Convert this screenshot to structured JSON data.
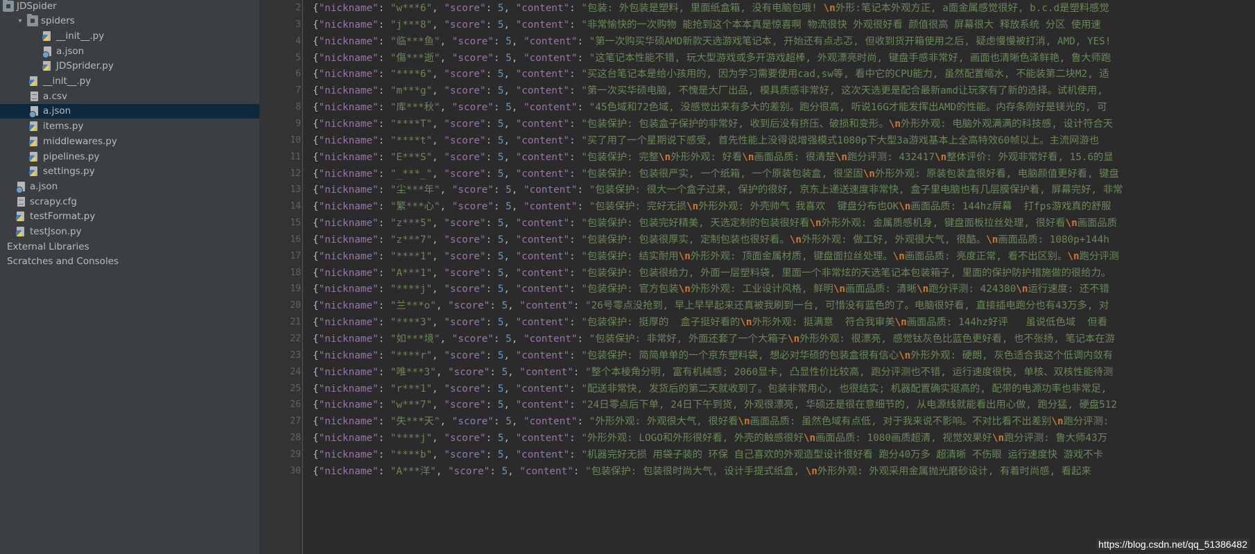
{
  "tree": [
    {
      "label": "JDSpider",
      "icon": "folder",
      "indent": 0,
      "arrow": ""
    },
    {
      "label": "spiders",
      "icon": "folder",
      "indent": 1,
      "arrow": "▾"
    },
    {
      "label": "__init__.py",
      "icon": "py",
      "indent": 3,
      "arrow": ""
    },
    {
      "label": "a.json",
      "icon": "json",
      "indent": 3,
      "arrow": ""
    },
    {
      "label": "JDSprider.py",
      "icon": "py",
      "indent": 3,
      "arrow": ""
    },
    {
      "label": "__init__.py",
      "icon": "py",
      "indent": 2,
      "arrow": ""
    },
    {
      "label": "a.csv",
      "icon": "csv",
      "indent": 2,
      "arrow": ""
    },
    {
      "label": "a.json",
      "icon": "json",
      "indent": 2,
      "arrow": "",
      "selected": true
    },
    {
      "label": "items.py",
      "icon": "py",
      "indent": 2,
      "arrow": ""
    },
    {
      "label": "middlewares.py",
      "icon": "py",
      "indent": 2,
      "arrow": ""
    },
    {
      "label": "pipelines.py",
      "icon": "py",
      "indent": 2,
      "arrow": ""
    },
    {
      "label": "settings.py",
      "icon": "py",
      "indent": 2,
      "arrow": ""
    },
    {
      "label": "a.json",
      "icon": "json",
      "indent": 1,
      "arrow": ""
    },
    {
      "label": "scrapy.cfg",
      "icon": "cfg",
      "indent": 1,
      "arrow": ""
    },
    {
      "label": "testFormat.py",
      "icon": "py",
      "indent": 1,
      "arrow": ""
    },
    {
      "label": "testJson.py",
      "icon": "py",
      "indent": 1,
      "arrow": ""
    },
    {
      "label": "External Libraries",
      "icon": "lib",
      "indent": 0,
      "arrow": ""
    },
    {
      "label": "Scratches and Consoles",
      "icon": "lib",
      "indent": 0,
      "arrow": ""
    }
  ],
  "code_keys": {
    "nickname": "\"nickname\"",
    "score": "\"score\"",
    "content": "\"content\""
  },
  "lines": [
    {
      "num": "2",
      "nickname": "w***6",
      "score": "5",
      "content": [
        "包装: 外包装是塑料, 里面纸盒箱, 没有电脑包哦! ",
        "\\n",
        "外形:笔记本外观方正, a面金属感觉很好, b.c.d是塑料感觉"
      ]
    },
    {
      "num": "3",
      "nickname": "j***8",
      "score": "5",
      "content": [
        "非常愉快的一次购物 能抢到这个本本真是惊喜啊 物流很快 外观很好看 颜值很高 屏幕很大 释放系统 分区 使用速"
      ]
    },
    {
      "num": "4",
      "nickname": "临***鱼",
      "score": "5",
      "content": [
        "第一次购买华硕AMD新款天选游戏笔记本, 开始还有点忐忑, 但收到货开箱使用之后, 疑虑慢慢被打消, AMD, YES!"
      ]
    },
    {
      "num": "5",
      "nickname": "傷***逝",
      "score": "5",
      "content": [
        "这笔记本性能不错, 玩大型游戏或多开游戏超棒, 外观漂亮时尚, 键盘手感非常好, 画面也清晰色泽鲜艳, 鲁大师跑"
      ]
    },
    {
      "num": "6",
      "nickname": "****6",
      "score": "5",
      "content": [
        "买这台笔记本是给小孩用的, 因为学习需要使用cad,sw等, 看中它的CPU能力, 虽然配置缩水, 不能装第二块M2, 适"
      ]
    },
    {
      "num": "7",
      "nickname": "m***g",
      "score": "5",
      "content": [
        "第一次买华硕电脑, 不愧是大厂出品, 模具质感非常好, 这次天选更是配合最新amd让玩家有了新的选择。试机使用,"
      ]
    },
    {
      "num": "8",
      "nickname": "库***秋",
      "score": "5",
      "content": [
        "45色域和72色域, 没感觉出来有多大的差别。跑分很高, 听说16G才能发挥出AMD的性能。内存条刚好是镁光的, 可"
      ]
    },
    {
      "num": "9",
      "nickname": "****T",
      "score": "5",
      "content": [
        "包装保护: 包装盒子保护的非常好, 收到后没有挤压、破损和变形。",
        "\\n",
        "外形外观: 电脑外观满满的科技感, 设计符合天"
      ]
    },
    {
      "num": "10",
      "nickname": "****t",
      "score": "5",
      "content": [
        "买了用了一个星期说下感受, 首先性能上没得说增强模式1080p下大型3a游戏基本上全高特效60帧以上。主流网游也"
      ]
    },
    {
      "num": "11",
      "nickname": "E***S",
      "score": "5",
      "content": [
        "包装保护: 完整",
        "\\n",
        "外形外观: 好看",
        "\\n",
        "画面品质: 很清楚",
        "\\n",
        "跑分评测: 432417",
        "\\n",
        "整体评价: 外观非常好看, 15.6的显"
      ]
    },
    {
      "num": "12",
      "nickname": "_***_",
      "score": "5",
      "content": [
        "包装保护: 包装很严实, 一个纸箱, 一个原装包装盒, 很坚固",
        "\\n",
        "外形外观: 原装包装盒很好看, 电脑颜值更好看, 键盘"
      ]
    },
    {
      "num": "13",
      "nickname": "尘***年",
      "score": "5",
      "content": [
        "包装保护: 很大一个盒子过来, 保护的很好, 京东上递送速度非常快, 盒子里电脑也有几层膜保护着, 屏幕完好, 非常"
      ]
    },
    {
      "num": "14",
      "nickname": "繁***心",
      "score": "5",
      "content": [
        "包装保护: 完好无损",
        "\\n",
        "外形外观: 外壳帅气 我喜欢  键盘分布也OK",
        "\\n",
        "画面品质: 144hz屏幕  打fps游戏真的舒服"
      ]
    },
    {
      "num": "15",
      "nickname": "z***5",
      "score": "5",
      "content": [
        "包装保护: 包装完好精美, 天选定制的包装很好看",
        "\\n",
        "外形外观: 金属质感机身, 键盘面板拉丝处理, 很好看",
        "\\n",
        "画面品质"
      ]
    },
    {
      "num": "16",
      "nickname": "z***7",
      "score": "5",
      "content": [
        "包装保护: 包装很厚实, 定制包装也很好看。",
        "\\n",
        "外形外观: 做工好, 外观很大气, 很酷。",
        "\\n",
        "画面品质: 1080p+144h"
      ]
    },
    {
      "num": "17",
      "nickname": "****1",
      "score": "5",
      "content": [
        "包装保护: 结实耐用",
        "\\n",
        "外形外观: 顶面金属材质, 键盘面拉丝处理。",
        "\\n",
        "画面品质: 亮度正常, 看不出区别。",
        "\\n",
        "跑分评测"
      ]
    },
    {
      "num": "18",
      "nickname": "A***1",
      "score": "5",
      "content": [
        "包装保护: 包装很给力, 外面一层塑料袋, 里面一个非常炫的天选笔记本包装箱子, 里面的保护防护措施做的很给力。"
      ]
    },
    {
      "num": "19",
      "nickname": "****j",
      "score": "5",
      "content": [
        "包装保护: 官方包装",
        "\\n",
        "外形外观: 工业设计风格, 鲜明",
        "\\n",
        "画面品质: 清晰",
        "\\n",
        "跑分评测: 424380",
        "\\n",
        "运行速度: 还不错"
      ]
    },
    {
      "num": "20",
      "nickname": "兰***o",
      "score": "5",
      "content": [
        "26号零点没抢到, 早上早早起来还真被我刷到一台, 可惜没有蓝色的了。电脑很好看, 直接插电跑分也有43万多, 对"
      ]
    },
    {
      "num": "21",
      "nickname": "****3",
      "score": "5",
      "content": [
        "包装保护: 挺厚的  盒子挺好看的",
        "\\n",
        "外形外观: 挺满意  符合我审美",
        "\\n",
        "画面品质: 144hz好评   虽说低色域  但看"
      ]
    },
    {
      "num": "22",
      "nickname": "如***境",
      "score": "5",
      "content": [
        "包装保护: 非常好, 外面还套了一个大箱子",
        "\\n",
        "外形外观: 很漂亮, 感觉钛灰色比蓝色更好看, 也不张扬, 笔记本在游"
      ]
    },
    {
      "num": "23",
      "nickname": "****r",
      "score": "5",
      "content": [
        "包装保护: 简简单单的一个京东塑料袋, 想必对华硕的包装盒很有信心",
        "\\n",
        "外形外观: 硬朗, 灰色适合我这个低调内敛有"
      ]
    },
    {
      "num": "24",
      "nickname": "唯***3",
      "score": "5",
      "content": [
        "整个本棱角分明, 富有机械感; 2060显卡, 凸显性价比较高, 跑分评测也不错, 运行速度很快, 单核、双核性能待测"
      ]
    },
    {
      "num": "25",
      "nickname": "r***1",
      "score": "5",
      "content": [
        "配送非常快, 发货后的第二天就收到了。包装非常用心, 也很结实; 机器配置确实挺高的, 配带的电源功率也非常足,"
      ]
    },
    {
      "num": "26",
      "nickname": "w***7",
      "score": "5",
      "content": [
        "24日零点后下单, 24日下午到货, 外观很漂亮, 华硕还是很在意细节的, 从电源线就能看出用心做, 跑分猛, 硬盘512"
      ]
    },
    {
      "num": "27",
      "nickname": "失***天",
      "score": "5",
      "content": [
        "外形外观: 外观很大气, 很好看",
        "\\n",
        "画面品质: 虽然色域有点低, 对于我来说不影响。不对比看不出差别",
        "\\n",
        "跑分评测:"
      ]
    },
    {
      "num": "28",
      "nickname": "****j",
      "score": "5",
      "content": [
        "外形外观: LOGO和外形很好看, 外壳的触感很好",
        "\\n",
        "画面品质: 1080画质超清, 视觉效果好",
        "\\n",
        "跑分评测: 鲁大师43万"
      ]
    },
    {
      "num": "29",
      "nickname": "****b",
      "score": "5",
      "content": [
        "机器完好无损 用袋子装的 环保 自己喜欢的外观造型设计很好看 跑分40万多 超清晰 不伤眼 运行速度快 游戏不卡"
      ]
    },
    {
      "num": "30",
      "nickname": "A***洋",
      "score": "5",
      "content": [
        "包装保护: 包装很时尚大气, 设计手提式纸盒, ",
        "\\n",
        "外形外观: 外观采用金属抛光磨砂设计, 有着时尚感, 看起来"
      ]
    }
  ],
  "watermark": "https://blog.csdn.net/qq_51386482",
  "colors": {
    "key": "#9876aa",
    "string": "#6a8759",
    "number": "#6897bb",
    "escape": "#cc7832",
    "selection": "#0d293e"
  }
}
